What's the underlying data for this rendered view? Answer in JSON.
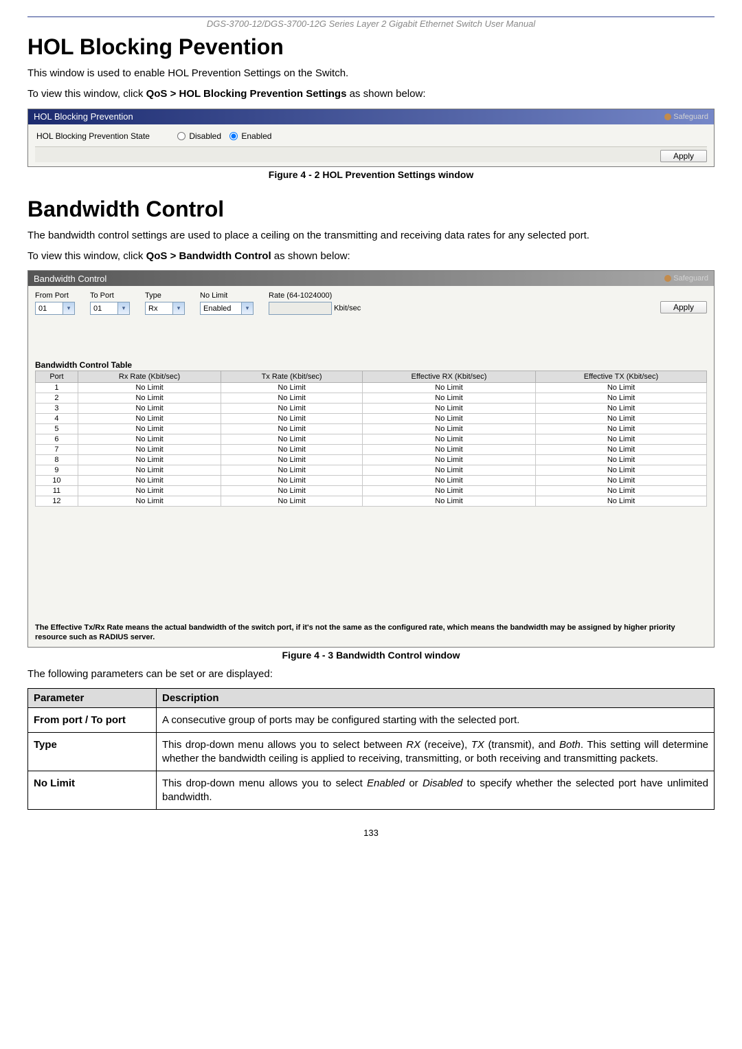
{
  "manualTitle": "DGS-3700-12/DGS-3700-12G Series Layer 2 Gigabit Ethernet Switch User Manual",
  "pageNumber": "133",
  "hol": {
    "h1": "HOL Blocking Pevention",
    "intro": "This window is used to enable HOL Prevention Settings on the Switch.",
    "nav_pre": "To view this window, click ",
    "nav_bold": "QoS > HOL Blocking Prevention Settings",
    "nav_post": " as shown below:",
    "panelTitle": "HOL Blocking Prevention",
    "safeguard": "Safeguard",
    "stateLabel": "HOL Blocking Prevention State",
    "radioDisabled": "Disabled",
    "radioEnabled": "Enabled",
    "applyLabel": "Apply",
    "figCaption": "Figure 4 - 2 HOL Prevention Settings window"
  },
  "bw": {
    "h1": "Bandwidth Control",
    "intro": "The bandwidth control settings are used to place a ceiling on the transmitting and receiving data rates for any selected port.",
    "nav_pre": "To view this window, click ",
    "nav_bold": "QoS > Bandwidth Control",
    "nav_post": " as shown below:",
    "panelTitle": "Bandwidth Control",
    "safeguard": "Safeguard",
    "labels": {
      "fromPort": "From Port",
      "toPort": "To Port",
      "type": "Type",
      "noLimit": "No Limit",
      "rate": "Rate (64-1024000)",
      "rateUnit": "Kbit/sec",
      "apply": "Apply"
    },
    "values": {
      "fromPort": "01",
      "toPort": "01",
      "type": "Rx",
      "noLimit": "Enabled",
      "rate": ""
    },
    "tableCaption": "Bandwidth Control Table",
    "tableHeaders": [
      "Port",
      "Rx Rate (Kbit/sec)",
      "Tx Rate (Kbit/sec)",
      "Effective RX (Kbit/sec)",
      "Effective TX (Kbit/sec)"
    ],
    "tableRows": [
      [
        "1",
        "No Limit",
        "No Limit",
        "No Limit",
        "No Limit"
      ],
      [
        "2",
        "No Limit",
        "No Limit",
        "No Limit",
        "No Limit"
      ],
      [
        "3",
        "No Limit",
        "No Limit",
        "No Limit",
        "No Limit"
      ],
      [
        "4",
        "No Limit",
        "No Limit",
        "No Limit",
        "No Limit"
      ],
      [
        "5",
        "No Limit",
        "No Limit",
        "No Limit",
        "No Limit"
      ],
      [
        "6",
        "No Limit",
        "No Limit",
        "No Limit",
        "No Limit"
      ],
      [
        "7",
        "No Limit",
        "No Limit",
        "No Limit",
        "No Limit"
      ],
      [
        "8",
        "No Limit",
        "No Limit",
        "No Limit",
        "No Limit"
      ],
      [
        "9",
        "No Limit",
        "No Limit",
        "No Limit",
        "No Limit"
      ],
      [
        "10",
        "No Limit",
        "No Limit",
        "No Limit",
        "No Limit"
      ],
      [
        "11",
        "No Limit",
        "No Limit",
        "No Limit",
        "No Limit"
      ],
      [
        "12",
        "No Limit",
        "No Limit",
        "No Limit",
        "No Limit"
      ]
    ],
    "footnote": "The Effective Tx/Rx Rate means the actual bandwidth of the switch port, if it's not the same as the configured rate, which means the bandwidth may be assigned by higher priority resource such as RADIUS server.",
    "figCaption": "Figure 4 - 3 Bandwidth Control window"
  },
  "paramsTable": {
    "intro": "The following parameters can be set or are displayed:",
    "headerParam": "Parameter",
    "headerDesc": "Description",
    "rows": [
      {
        "name": "From port / To port",
        "desc_plain": "A consecutive group of ports may be configured starting with the selected port."
      },
      {
        "name": "Type",
        "desc_html": "This drop-down menu allows you to select between <i>RX</i> (receive), <i>TX</i> (transmit), and <i>Both</i>. This setting will determine whether the bandwidth ceiling is applied to receiving, transmitting, or both receiving and transmitting packets."
      },
      {
        "name": "No Limit",
        "desc_html": "This drop-down menu allows you to select <i>Enabled</i> or <i>Disabled</i> to specify whether the selected port have unlimited bandwidth."
      }
    ]
  }
}
